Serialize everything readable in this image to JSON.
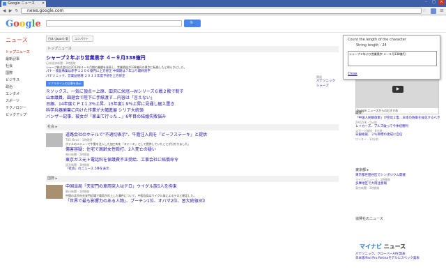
{
  "browser": {
    "tab_title": "Google ニュース",
    "url": "news.google.com",
    "colors": {
      "tabbar": "#3c5fa8",
      "accent": "#4787ed"
    }
  },
  "header": {
    "logo_letters": [
      "G",
      "o",
      "o",
      "g",
      "l",
      "e"
    ],
    "search_button": "🔍",
    "news_label": "ニュース",
    "edition_label": "日本 (Japan) 版",
    "layout_label": "コンパクト"
  },
  "sidenav": [
    "トップニュース",
    "最新記事",
    "社会",
    "国際",
    "ビジネス",
    "政治",
    "エンタメ",
    "スポーツ",
    "テクノロジー",
    "ピックアップ"
  ],
  "top": {
    "section": "トップニュース",
    "lead_title": "シャープ２年ぶり営業黒字 ４－９月338億円",
    "lead_source": "日本経済新聞 - 3時間前",
    "lead_snippet": "シャープ株式会社は2013年４～９月期の業績を発表し、営業損益が338億円の黒字に転換したと明らかにした。",
    "related": [
      "パナ・液晶事業は赤字１２００億円に上方修正 中間期は７年ぶり最終黒字",
      "パナソニック、営業益倍増 ２０１３年度予想を上方修正"
    ],
    "badge": "リアルタイムの記事を表示",
    "headlines": [
      "Ｒソックス、一気に頂点＝上原、田沢に栄冠―Ｗシリーズ６戦２敗で制す",
      "山本議員、園遊会で陛下に手紙渡す…内容は「言えない」",
      "日銀、14年度ＣＰＩ1.3％上昇、15年度1.9％上昇に見通し据え置き",
      "科学兵器廃棄に向けた作業が大幅進展 シリア大統領",
      "バンザー記事、彼女が「家出て行った…」6年目の結婚失敗悩み"
    ],
    "side_label": "関連",
    "side_links": [
      "パナソニック",
      "シャープ"
    ]
  },
  "society": {
    "section": "社会 ▸",
    "items": [
      {
        "title": "道路会社のホテルで\"不適切表示\"、牛脂注入肉を「ビーフステーキ」と提供",
        "source": "TBS News - 1時間前",
        "snippet": "ホテルのメニューで牛脂を注入した加工肉を「ステーキ」として提供していたことが分かりました。"
      },
      {
        "title": "傷害容疑：住宅で高齢女性殴打、2人死亡の疑い",
        "source": "毎日新聞 - 2時間前",
        "snippet": ""
      },
      {
        "title": "東京ガス元ト電話料を保護費不正受給、工事会社に賠償命令",
        "source": "読売新聞 - 3時間前",
        "snippet": ""
      }
    ],
    "more": "「社会」のニュース 5件を表示"
  },
  "world": {
    "section": "国際 ▸",
    "items": [
      {
        "title": "中国当局「天安門の車両突入はテロ」ウイグル族5人を拘束",
        "source": "朝日新聞 - 1時間前",
        "snippet": "中国の北京市天安門広場で車両が炎上した事件について、中国当局はウイグル族によるテロと断定した。"
      },
      {
        "title": "「世界で最も影響力のある人物」、プーチン1位、オバマ2位、習大統領3位",
        "source": "",
        "snippet": ""
      }
    ]
  },
  "right": {
    "video_caption": "Google ニュースからのおすすめ",
    "recent_title": "最新",
    "recent": [
      {
        "title": "「中国人民解放軍」が空母２隻…日本の防衛を強化するべき",
        "src": "ZAKZAK - 5分前"
      },
      {
        "title": "レイカーズ、ブルズ破って今季初勝利",
        "src": "スポーツ報知 - 8分前"
      },
      {
        "title": "日銀総裁、２％目標の達成に自信",
        "src": "ロイター - 10分前"
      }
    ],
    "tokyo_title": "東京都 ▸",
    "tokyo": [
      {
        "title": "東京都世田谷区でシンポジウム開催",
        "src": "マイナビニュース - 1時間前"
      },
      {
        "title": "多摩地区で大雨注意報",
        "src": "東京新聞 - 2時間前"
      }
    ],
    "sponsor_title": "協賛社のニュース",
    "sponsor_brand_1": "マイナビ",
    "sponsor_brand_2": "ニュース",
    "sponsor_links": [
      "パナソニック、クローバーAIを発表",
      "日本版iPad Pro Retinaモデルにスペック発表"
    ]
  },
  "popup": {
    "heading": "Count the length of the character",
    "length_label": "String length :",
    "length_value": "24",
    "text_value": "シャープ２年ぶり営業黒字 ４－９月338億円",
    "close_label": "Close"
  }
}
